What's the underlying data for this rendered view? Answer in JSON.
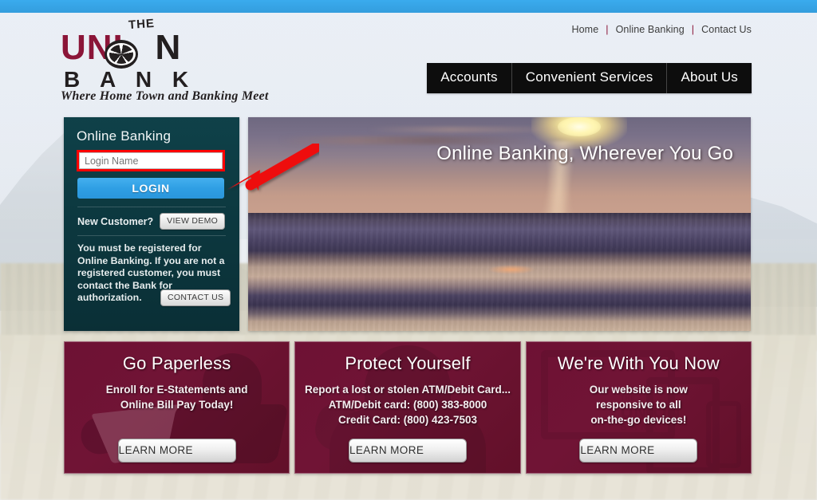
{
  "site": {
    "logo": {
      "the": "THE",
      "word_left": "UNI",
      "word_right": "N",
      "bank": "B A N K",
      "tagline": "Where Home Town and Banking Meet",
      "brand_color": "#8b1538"
    },
    "utility_nav": [
      {
        "label": "Home"
      },
      {
        "label": "Online Banking"
      },
      {
        "label": "Contact Us"
      }
    ],
    "utility_separator": "|",
    "main_nav": [
      {
        "label": "Accounts"
      },
      {
        "label": "Convenient Services"
      },
      {
        "label": "About Us"
      }
    ],
    "topbar_color": "#38a8e8"
  },
  "login": {
    "title": "Online Banking",
    "input_placeholder": "Login Name",
    "input_value": "",
    "submit_label": "LOGIN",
    "submit_color": "#2f9fe4",
    "new_customer_label": "New Customer?",
    "view_demo_label": "VIEW DEMO",
    "note": "You must be registered for Online Banking. If you are not a registered customer, you must contact the Bank for authorization.",
    "contact_us_label": "CONTACT US",
    "panel_color": "#0c373e",
    "highlight_color": "#ff0000"
  },
  "hero": {
    "caption": "Online Banking, Wherever You Go",
    "alt": "sunset-over-ocean-photo"
  },
  "annotation": {
    "arrow_color": "#ee1111",
    "points_to": "login-button"
  },
  "cards": [
    {
      "title": "Go Paperless",
      "lines": [
        "Enroll for E-Statements and",
        "Online Bill Pay Today!"
      ],
      "button": "LEARN MORE",
      "art": "woman-with-laptop-silhouette"
    },
    {
      "title": "Protect Yourself",
      "lines": [
        "Report a lost or stolen ATM/Debit Card...",
        "ATM/Debit card: (800) 383-8000",
        "Credit Card: (800) 423-7503"
      ],
      "button": "LEARN MORE",
      "art": "hooded-figure-silhouette"
    },
    {
      "title": "We're With You Now",
      "lines": [
        "Our website is now",
        "responsive to all",
        "on-the-go devices!"
      ],
      "button": "LEARN MORE",
      "art": "monitor-tablet-phone-devices"
    }
  ],
  "card_theme": {
    "background": "#6e1134",
    "text": "#ffffff"
  }
}
